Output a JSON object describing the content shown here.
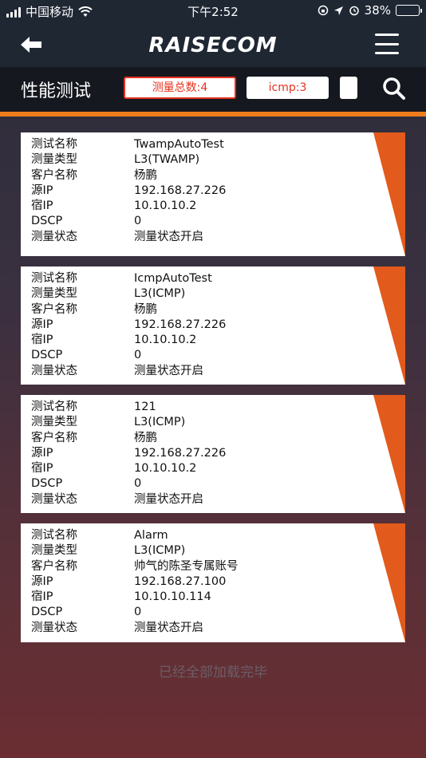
{
  "status_bar": {
    "carrier": "中国移动",
    "time": "下午2:52",
    "battery": "38%",
    "battery_level": 0.38
  },
  "nav": {
    "logo": "RAISECOM",
    "back_icon": "back-arrow-icon",
    "menu_icon": "hamburger-menu-icon"
  },
  "header": {
    "title": "性能测试",
    "chips": {
      "total": "测量总数:4",
      "icmp": "icmp:3"
    },
    "search_icon": "search-icon"
  },
  "colors": {
    "accent": "#f07d1c",
    "chip_text": "#e8311e",
    "corner": "#e25a1c",
    "nav_bg": "#1f2733"
  },
  "labels": {
    "name": "测试名称",
    "type": "测量类型",
    "customer": "客户名称",
    "src_ip": "源IP",
    "dst_ip": "宿IP",
    "dscp": "DSCP",
    "status": "测量状态"
  },
  "cards": [
    {
      "name": "TwampAutoTest",
      "type": "L3(TWAMP)",
      "customer": "杨鹏",
      "src_ip": "192.168.27.226",
      "dst_ip": "10.10.10.2",
      "dscp": "0",
      "status": "测量状态开启"
    },
    {
      "name": "IcmpAutoTest",
      "type": "L3(ICMP)",
      "customer": "杨鹏",
      "src_ip": "192.168.27.226",
      "dst_ip": "10.10.10.2",
      "dscp": "0",
      "status": "测量状态开启"
    },
    {
      "name": "121",
      "type": "L3(ICMP)",
      "customer": "杨鹏",
      "src_ip": "192.168.27.226",
      "dst_ip": "10.10.10.2",
      "dscp": "0",
      "status": "测量状态开启"
    },
    {
      "name": "Alarm",
      "type": "L3(ICMP)",
      "customer": "帅气的陈圣专属账号",
      "src_ip": "192.168.27.100",
      "dst_ip": "10.10.10.114",
      "dscp": "0",
      "status": "测量状态开启"
    }
  ],
  "footer": "已经全部加载完毕"
}
